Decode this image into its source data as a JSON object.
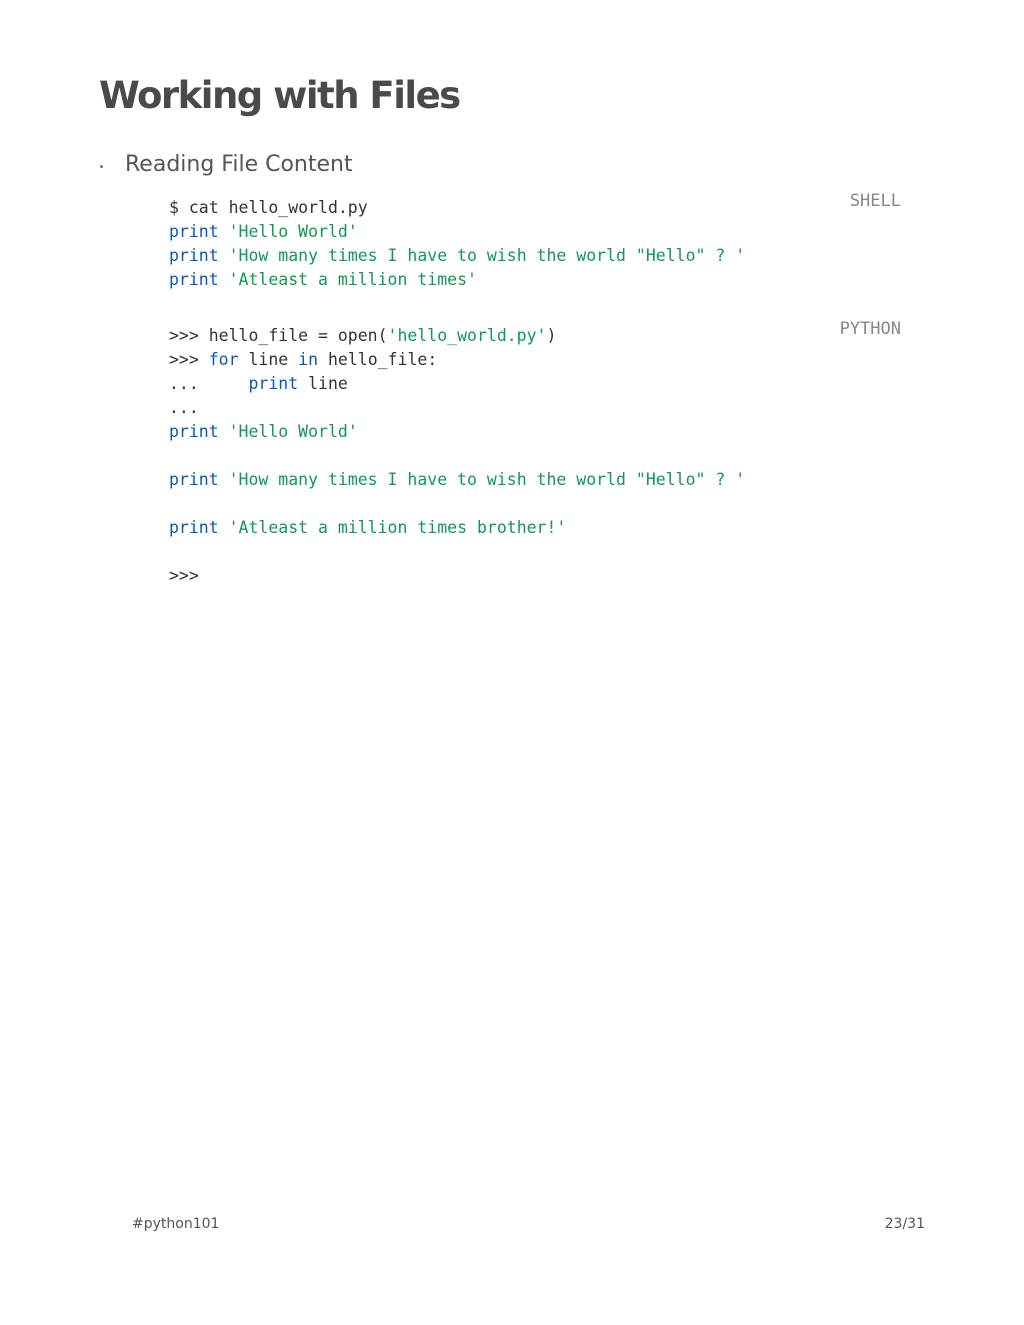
{
  "slide": {
    "title": "Working with Files",
    "bullet": "Reading File Content"
  },
  "shell_block": {
    "language": "SHELL",
    "lines": [
      [
        {
          "t": "$ cat hello_world.py",
          "c": "plain"
        }
      ],
      [
        {
          "t": "print",
          "c": "kw"
        },
        {
          "t": " ",
          "c": "plain"
        },
        {
          "t": "'Hello World'",
          "c": "str"
        }
      ],
      [
        {
          "t": "print",
          "c": "kw"
        },
        {
          "t": " ",
          "c": "plain"
        },
        {
          "t": "'How many times I have to wish the world \"Hello\" ? '",
          "c": "str"
        }
      ],
      [
        {
          "t": "print",
          "c": "kw"
        },
        {
          "t": " ",
          "c": "plain"
        },
        {
          "t": "'Atleast a million times'",
          "c": "str"
        }
      ]
    ]
  },
  "python_block": {
    "language": "PYTHON",
    "lines": [
      [
        {
          "t": ">>> hello_file = open(",
          "c": "plain"
        },
        {
          "t": "'hello_world.py'",
          "c": "str"
        },
        {
          "t": ")",
          "c": "plain"
        }
      ],
      [
        {
          "t": ">>> ",
          "c": "plain"
        },
        {
          "t": "for",
          "c": "kw"
        },
        {
          "t": " line ",
          "c": "plain"
        },
        {
          "t": "in",
          "c": "kw"
        },
        {
          "t": " hello_file:",
          "c": "plain"
        }
      ],
      [
        {
          "t": "...     ",
          "c": "plain"
        },
        {
          "t": "print",
          "c": "kw"
        },
        {
          "t": " line",
          "c": "plain"
        }
      ],
      [
        {
          "t": "...",
          "c": "plain"
        }
      ],
      [
        {
          "t": "print",
          "c": "kw"
        },
        {
          "t": " ",
          "c": "plain"
        },
        {
          "t": "'Hello World'",
          "c": "str"
        }
      ],
      [],
      [
        {
          "t": "print",
          "c": "kw"
        },
        {
          "t": " ",
          "c": "plain"
        },
        {
          "t": "'How many times I have to wish the world \"Hello\" ? '",
          "c": "str"
        }
      ],
      [],
      [
        {
          "t": "print",
          "c": "kw"
        },
        {
          "t": " ",
          "c": "plain"
        },
        {
          "t": "'Atleast a million times brother!'",
          "c": "str"
        }
      ],
      [],
      [
        {
          "t": ">>>",
          "c": "plain"
        }
      ]
    ]
  },
  "footer": {
    "hashtag": "#python101",
    "page": "23/31"
  },
  "colors": {
    "keyword": "#0a56c2",
    "string": "#119955",
    "text": "#333333"
  }
}
